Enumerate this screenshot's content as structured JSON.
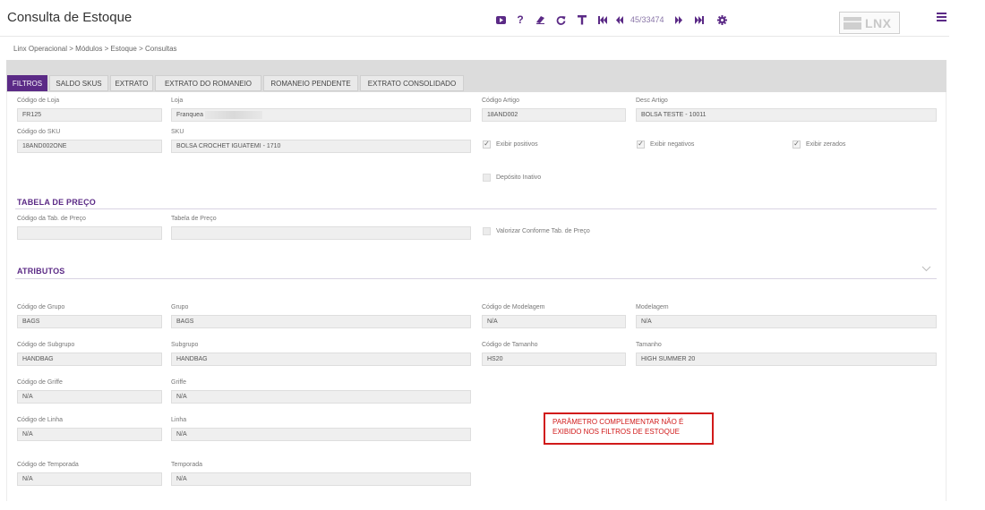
{
  "header": {
    "title": "Consulta de Estoque",
    "toolbar": [
      {
        "icon": "youtube-icon",
        "glyph": "▶"
      },
      {
        "icon": "help-icon",
        "glyph": "?"
      },
      {
        "icon": "eraser-icon",
        "glyph": "✎"
      },
      {
        "icon": "refresh-icon",
        "glyph": "↻"
      },
      {
        "icon": "filter-icon",
        "glyph": "T"
      },
      {
        "icon": "first-record-icon",
        "glyph": "|◀"
      },
      {
        "icon": "previous-record-icon",
        "glyph": "◀◀"
      },
      {
        "icon": "next-record-icon",
        "glyph": "▶▶"
      },
      {
        "icon": "last-record-icon",
        "glyph": "▶|"
      },
      {
        "icon": "settings-icon",
        "glyph": "⚙"
      }
    ],
    "record_position": "45/33474",
    "logo_text": "LNX",
    "accent_color": "#5b2a86"
  },
  "breadcrumb": "Linx Operacional  >  Módulos  >  Estoque  >  Consultas",
  "tabs": [
    "FILTROS",
    "SALDO SKUS",
    "EXTRATO",
    "EXTRATO DO ROMANEIO",
    "ROMANEIO PENDENTE",
    "EXTRATO CONSOLIDADO"
  ],
  "active_tab": "FILTROS",
  "filtros": {
    "codigo_loja": {
      "label": "Código de Loja",
      "value": "FR125"
    },
    "loja": {
      "label": "Loja",
      "value": "Franquea"
    },
    "codigo_artigo": {
      "label": "Código Artigo",
      "value": "18AND002"
    },
    "desc_artigo": {
      "label": "Desc Artigo",
      "value": "BOLSA TESTE - 10011"
    },
    "codigo_sku": {
      "label": "Código do SKU",
      "value": "18AND002ONE"
    },
    "sku": {
      "label": "SKU",
      "value": "BOLSA CROCHET IGUATEMI - 1710"
    },
    "exibir_positivos": {
      "label": "Exibir positivos",
      "checked": true
    },
    "exibir_negativos": {
      "label": "Exibir negativos",
      "checked": true
    },
    "exibir_zerados": {
      "label": "Exibir zerados",
      "checked": true
    },
    "deposito_inativo": {
      "label": "Depósito Inativo",
      "checked": false
    }
  },
  "tabela_preco": {
    "heading": "TABELA DE PREÇO",
    "codigo_tab": {
      "label": "Código da Tab. de Preço",
      "value": ""
    },
    "tabela": {
      "label": "Tabela de Preço",
      "value": ""
    },
    "valorizar": {
      "label": "Valorizar Conforme Tab. de Preço",
      "checked": false
    }
  },
  "atributos": {
    "heading": "ATRIBUTOS",
    "codigo_grupo": {
      "label": "Código de Grupo",
      "value": "BAGS"
    },
    "grupo": {
      "label": "Grupo",
      "value": "BAGS"
    },
    "codigo_modelagem": {
      "label": "Código de Modelagem",
      "value": "N/A"
    },
    "modelagem": {
      "label": "Modelagem",
      "value": "N/A"
    },
    "codigo_subgrupo": {
      "label": "Código de Subgrupo",
      "value": "HANDBAG"
    },
    "subgrupo": {
      "label": "Subgrupo",
      "value": "HANDBAG"
    },
    "codigo_tamanho": {
      "label": "Código de Tamanho",
      "value": "HS20"
    },
    "tamanho": {
      "label": "Tamanho",
      "value": "HIGH SUMMER 20"
    },
    "codigo_griffe": {
      "label": "Código de Griffe",
      "value": "N/A"
    },
    "griffe": {
      "label": "Griffe",
      "value": "N/A"
    },
    "codigo_linha": {
      "label": "Código de Linha",
      "value": "N/A"
    },
    "linha": {
      "label": "Linha",
      "value": "N/A"
    },
    "codigo_temporada": {
      "label": "Código de Temporada",
      "value": "N/A"
    },
    "temporada": {
      "label": "Temporada",
      "value": "N/A"
    }
  },
  "annotation": {
    "line1": "PARÂMETRO COMPLEMENTAR NÃO É",
    "line2": "EXIBIDO NOS FILTROS DE ESTOQUE",
    "color": "#d11a1a"
  }
}
